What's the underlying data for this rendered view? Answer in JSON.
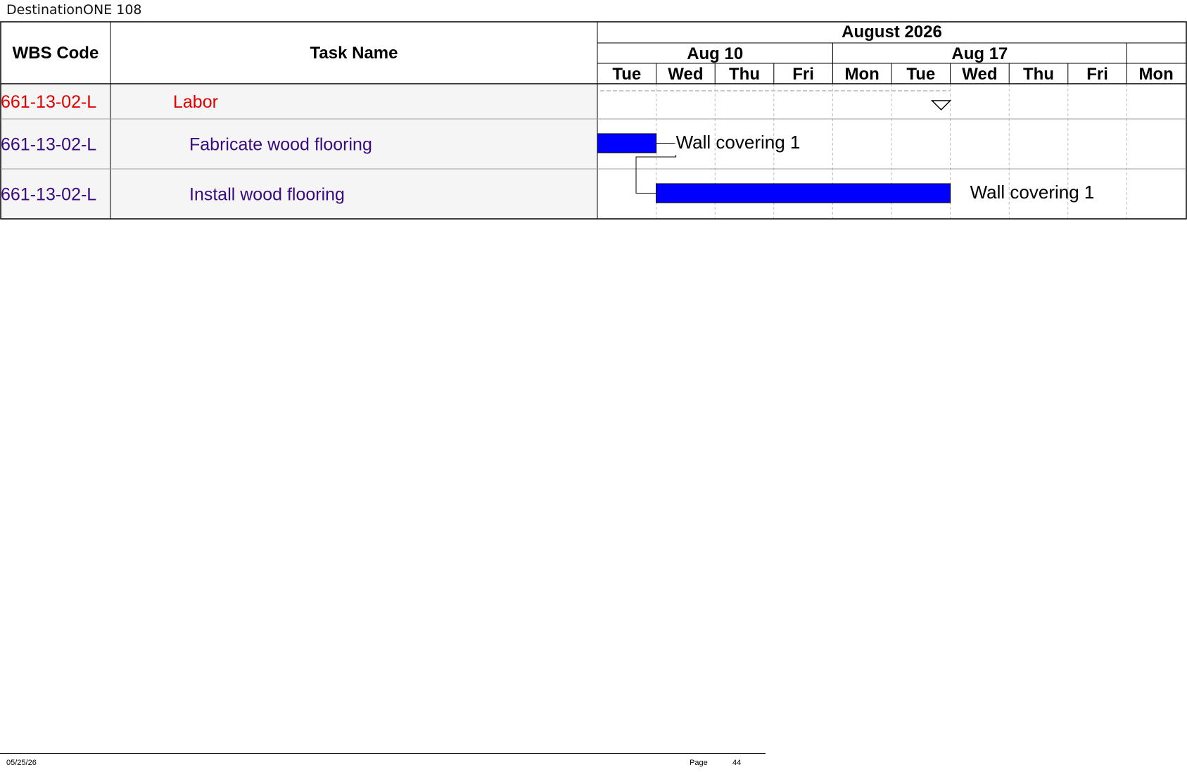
{
  "document": {
    "title": "DestinationONE 108"
  },
  "columns": {
    "wbs": "WBS Code",
    "task": "Task Name"
  },
  "timeline": {
    "month": "August 2026",
    "weeks": [
      "Aug 10",
      "Aug 17"
    ],
    "days": [
      "Tue",
      "Wed",
      "Thu",
      "Fri",
      "Mon",
      "Tue",
      "Wed",
      "Thu",
      "Fri",
      "Mon"
    ]
  },
  "rows": [
    {
      "wbs": "661-13-02-L",
      "task": "Labor",
      "kind": "summary",
      "color": "#e00000"
    },
    {
      "wbs": "661-13-02-L",
      "task": "Fabricate wood flooring",
      "kind": "task",
      "color": "#3a0a82",
      "start": 0,
      "end": 1,
      "resource": "Wall covering 1"
    },
    {
      "wbs": "661-13-02-L",
      "task": "Install wood flooring",
      "kind": "task",
      "color": "#3a0a82",
      "start": 1,
      "end": 6,
      "resource": "Wall covering 1"
    }
  ],
  "summary_marker_day": 6,
  "colors": {
    "bar": "#0000ff",
    "summary_text": "#e00000",
    "task_text": "#3a0a82",
    "row_bg": "#f5f5f5"
  },
  "footer": {
    "date": "05/25/26",
    "page_label": "Page",
    "page_number": "44"
  }
}
